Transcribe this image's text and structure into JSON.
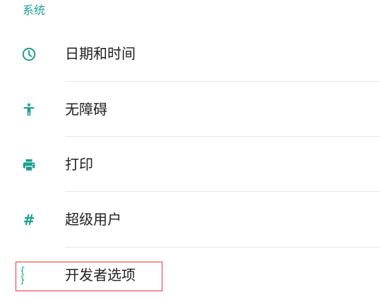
{
  "section": {
    "title": "系统"
  },
  "items": [
    {
      "label": "日期和时间",
      "icon": "clock-icon"
    },
    {
      "label": "无障碍",
      "icon": "accessibility-icon"
    },
    {
      "label": "打印",
      "icon": "printer-icon"
    },
    {
      "label": "超级用户",
      "icon": "hash-icon",
      "glyph": "#"
    },
    {
      "label": "开发者选项",
      "icon": "braces-icon",
      "glyph": "{ }"
    }
  ],
  "colors": {
    "accent": "#1a9e8f",
    "text": "#212121",
    "divider": "#e6e6e6",
    "highlight": "#e0393a"
  }
}
